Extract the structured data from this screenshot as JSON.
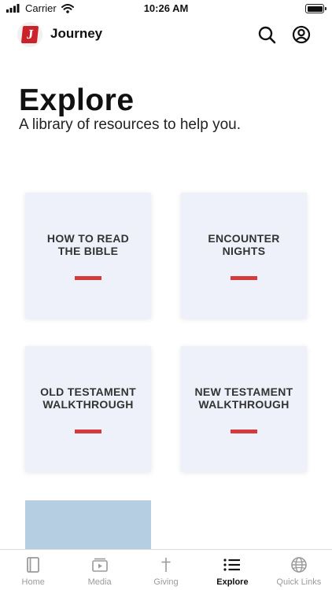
{
  "status_bar": {
    "carrier": "Carrier",
    "time": "10:26 AM"
  },
  "header": {
    "app_name": "Journey",
    "logo_letter": "J",
    "icons": {
      "search": "search-icon",
      "account": "account-icon"
    }
  },
  "main": {
    "title": "Explore",
    "subtitle": "A library of resources to help you."
  },
  "cards": [
    {
      "label": "HOW TO READ\nTHE BIBLE"
    },
    {
      "label": "ENCOUNTER\nNIGHTS"
    },
    {
      "label": "OLD TESTAMENT\nWALKTHROUGH"
    },
    {
      "label": "NEW TESTAMENT\nWALKTHROUGH"
    }
  ],
  "tabs": [
    {
      "label": "Home",
      "icon": "book-icon"
    },
    {
      "label": "Media",
      "icon": "media-player-icon"
    },
    {
      "label": "Giving",
      "icon": "cross-icon"
    },
    {
      "label": "Explore",
      "icon": "list-icon",
      "active": true
    },
    {
      "label": "Quick Links",
      "icon": "globe-icon"
    }
  ],
  "colors": {
    "accent": "#d63b3b",
    "card_bg": "#eef1f9",
    "active_tab": "#111111",
    "inactive_tab": "#9b9b9b",
    "brand": "#cc2229"
  }
}
